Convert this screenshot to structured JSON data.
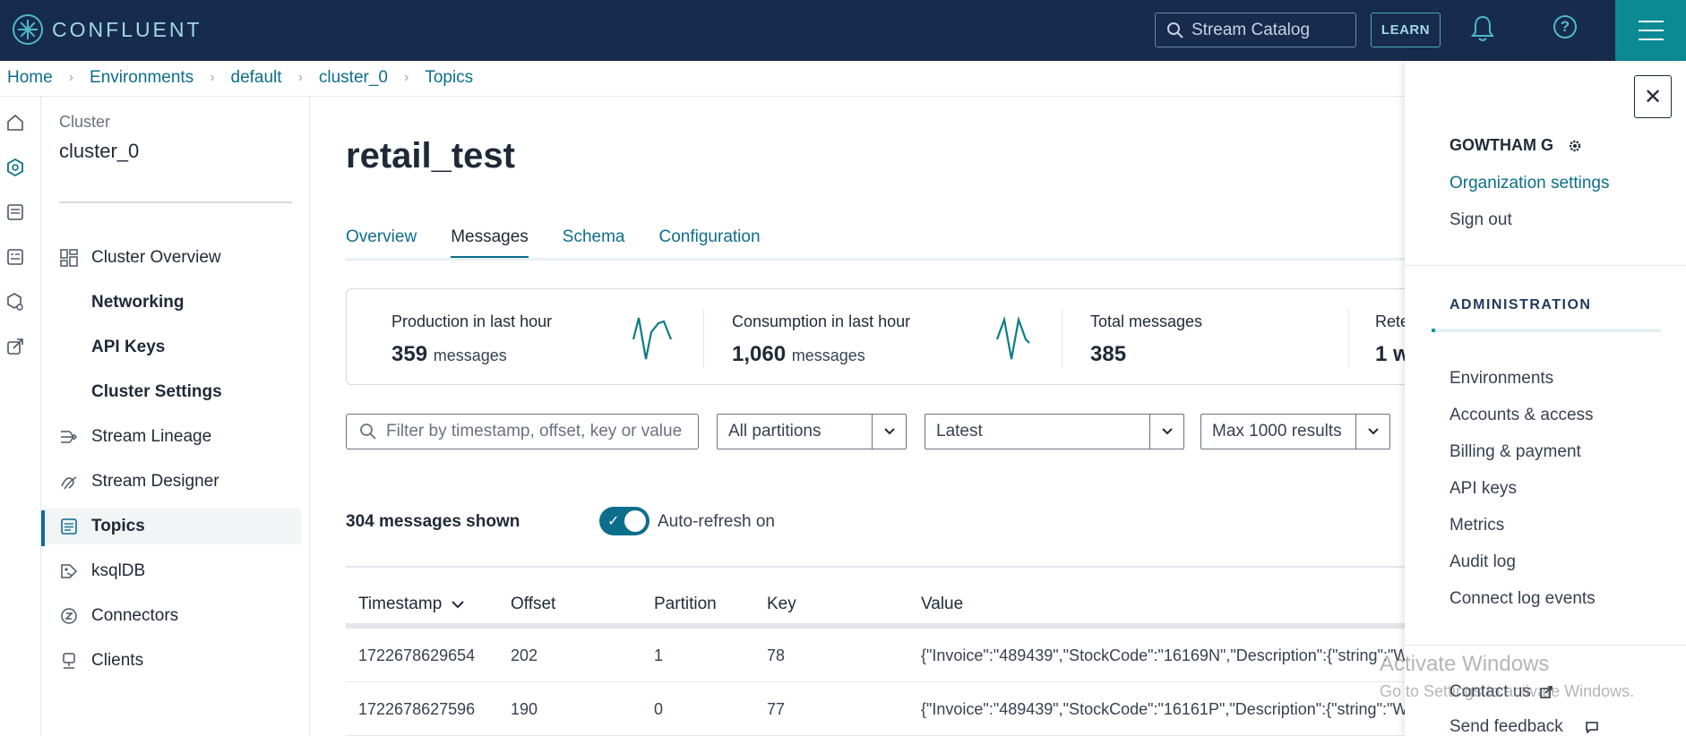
{
  "header": {
    "logo_text": "CONFLUENT",
    "search_placeholder": "Stream Catalog",
    "learn_label": "LEARN"
  },
  "breadcrumb": [
    "Home",
    "Environments",
    "default",
    "cluster_0",
    "Topics"
  ],
  "sidebar": {
    "cluster_label": "Cluster",
    "cluster_name": "cluster_0",
    "items": [
      {
        "label": "Cluster Overview",
        "icon": "dashboard-icon"
      },
      {
        "label": "Networking",
        "icon": ""
      },
      {
        "label": "API Keys",
        "icon": ""
      },
      {
        "label": "Cluster Settings",
        "icon": ""
      },
      {
        "label": "Stream Lineage",
        "icon": "lineage-icon"
      },
      {
        "label": "Stream Designer",
        "icon": "designer-icon"
      },
      {
        "label": "Topics",
        "icon": "topics-icon",
        "active": true
      },
      {
        "label": "ksqlDB",
        "icon": "ksqldb-icon"
      },
      {
        "label": "Connectors",
        "icon": "connectors-icon"
      },
      {
        "label": "Clients",
        "icon": "clients-icon"
      }
    ]
  },
  "main": {
    "title": "retail_test",
    "tabs": [
      "Overview",
      "Messages",
      "Schema",
      "Configuration"
    ],
    "active_tab": "Messages",
    "stats": {
      "production_label": "Production in last hour",
      "production_value": "359",
      "production_unit": "messages",
      "consumption_label": "Consumption in last hour",
      "consumption_value": "1,060",
      "consumption_unit": "messages",
      "total_label": "Total messages",
      "total_value": "385",
      "retention_label": "Rete",
      "retention_value": "1 w"
    },
    "filters": {
      "search_placeholder": "Filter by timestamp, offset, key or value",
      "partitions": "All partitions",
      "position": "Latest",
      "max_results": "Max 1000 results"
    },
    "messages_shown": "304 messages shown",
    "auto_refresh_label": "Auto-refresh on",
    "auto_refresh_on": true,
    "table": {
      "columns": [
        "Timestamp",
        "Offset",
        "Partition",
        "Key",
        "Value"
      ],
      "rows": [
        {
          "timestamp": "1722678629654",
          "offset": "202",
          "partition": "1",
          "key": "78",
          "value": "{\"Invoice\":\"489439\",\"StockCode\":\"16169N\",\"Description\":{\"string\":\"W"
        },
        {
          "timestamp": "1722678627596",
          "offset": "190",
          "partition": "0",
          "key": "77",
          "value": "{\"Invoice\":\"489439\",\"StockCode\":\"16161P\",\"Description\":{\"string\":\"W"
        }
      ]
    }
  },
  "panel": {
    "user_name": "GOWTHAM G",
    "org_settings": "Organization settings",
    "sign_out": "Sign out",
    "admin_heading": "ADMINISTRATION",
    "admin_items": [
      "Environments",
      "Accounts & access",
      "Billing & payment",
      "API keys",
      "Metrics",
      "Audit log",
      "Connect log events"
    ],
    "contact_us": "Contact us",
    "send_feedback": "Send feedback"
  },
  "watermark": {
    "line1": "Activate Windows",
    "line2": "Go to Settings to activate Windows."
  },
  "colors": {
    "topbar": "#172b4d",
    "accent": "#0d6e8c",
    "menu_button": "#0b8a94"
  }
}
